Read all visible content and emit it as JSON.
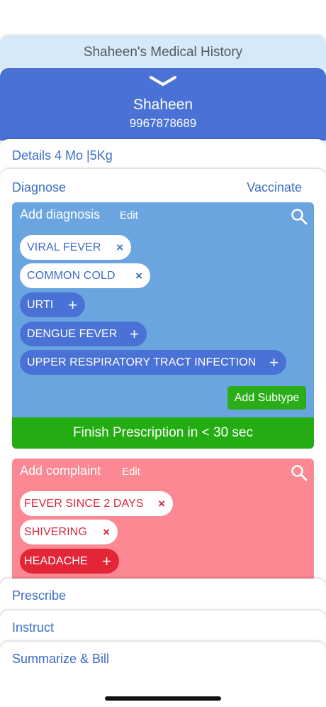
{
  "header": {
    "title": "Shaheen's Medical History"
  },
  "patient": {
    "name": "Shaheen",
    "phone": "9967878689"
  },
  "details": {
    "label": "Details 4 Mo |5Kg"
  },
  "tabs": {
    "diagnose": "Diagnose",
    "vaccinate": "Vaccinate"
  },
  "diagnosis": {
    "title": "Add diagnosis",
    "edit": "Edit",
    "chips": [
      {
        "label": "VIRAL FEVER",
        "state": "selected",
        "mark": "×"
      },
      {
        "label": "COMMON COLD",
        "state": "selected",
        "mark": "×"
      },
      {
        "label": "URTI",
        "state": "suggested",
        "mark": "+"
      },
      {
        "label": "DENGUE FEVER",
        "state": "suggested",
        "mark": "+"
      },
      {
        "label": "UPPER RESPIRATORY TRACT INFECTION",
        "state": "suggested",
        "mark": "+"
      }
    ],
    "add_subtype": "Add Subtype",
    "finish": "Finish Prescription in < 30 sec"
  },
  "complaint": {
    "title": "Add complaint",
    "edit": "Edit",
    "chips": [
      {
        "label": "FEVER SINCE 2 DAYS",
        "state": "selected",
        "mark": "×"
      },
      {
        "label": "SHIVERING",
        "state": "selected",
        "mark": "×"
      },
      {
        "label": "HEADACHE",
        "state": "suggested",
        "mark": "+"
      }
    ]
  },
  "nav": {
    "prescribe": "Prescribe",
    "instruct": "Instruct",
    "summarize": "Summarize & Bill"
  },
  "colors": {
    "primary_blue": "#4a72d6",
    "diagnosis_bg": "#6ba5e0",
    "complaint_bg": "#fb8893",
    "action_green": "#24ad12",
    "complaint_red": "#e32538"
  }
}
